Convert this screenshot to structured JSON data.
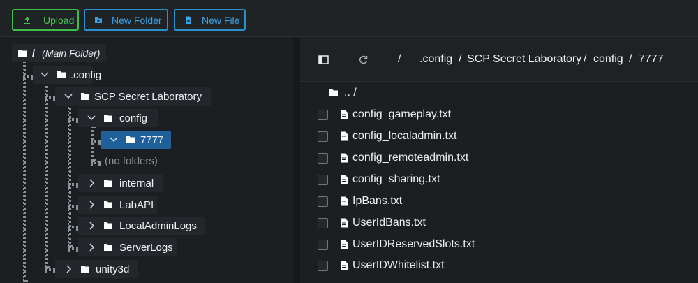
{
  "toolbar": {
    "upload_label": "Upload",
    "new_folder_label": "New Folder",
    "new_file_label": "New File",
    "upload_color": "#43c84d",
    "accent_color": "#3aa2e6"
  },
  "tree": {
    "root_label": "/",
    "root_note": "(Main Folder)",
    "config_dir": ".config",
    "scp": "SCP Secret Laboratory",
    "config": "config",
    "selected": "7777",
    "no_folders": "(no folders)",
    "internal": "internal",
    "labapi": "LabAPI",
    "localadminlogs": "LocalAdminLogs",
    "serverlogs": "ServerLogs",
    "unity3d": "unity3d",
    "selected_color": "#1f5f9a"
  },
  "path": {
    "root": "/",
    "seg1": ".config",
    "sep1": "/",
    "seg2": "SCP Secret Laboratory",
    "sep2": "/",
    "seg3": "config",
    "sep3": "/",
    "seg4": "7777"
  },
  "files": {
    "parent": ".. /",
    "items": [
      "config_gameplay.txt",
      "config_localadmin.txt",
      "config_remoteadmin.txt",
      "config_sharing.txt",
      "IpBans.txt",
      "UserIdBans.txt",
      "UserIDReservedSlots.txt",
      "UserIDWhitelist.txt"
    ]
  }
}
